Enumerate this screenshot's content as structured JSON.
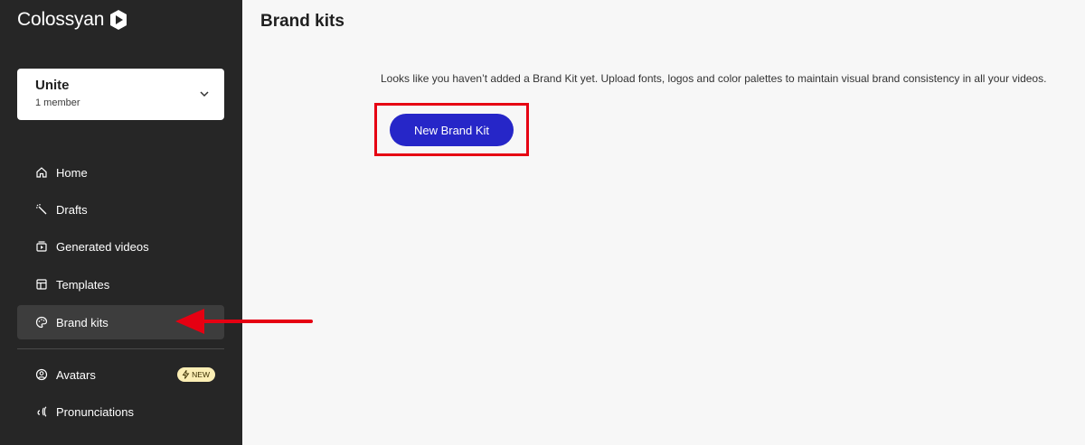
{
  "app": {
    "name": "Colossyan"
  },
  "workspace": {
    "name": "Unite",
    "members": "1 member"
  },
  "sidebar": {
    "items": [
      {
        "label": "Home",
        "icon": "home-icon"
      },
      {
        "label": "Drafts",
        "icon": "magic-wand-icon"
      },
      {
        "label": "Generated videos",
        "icon": "video-library-icon"
      },
      {
        "label": "Templates",
        "icon": "template-icon"
      },
      {
        "label": "Brand kits",
        "icon": "palette-icon",
        "active": true
      },
      {
        "label": "Avatars",
        "icon": "avatar-icon",
        "badge": "NEW"
      },
      {
        "label": "Pronunciations",
        "icon": "pronunciation-icon"
      }
    ]
  },
  "main": {
    "title": "Brand kits",
    "empty_message": "Looks like you haven’t added a Brand Kit yet. Upload fonts, logos and color palettes to maintain visual brand consistency in all your videos.",
    "new_button": "New Brand Kit"
  },
  "colors": {
    "sidebar_bg": "#262626",
    "primary_button": "#2626c8",
    "annotation_red": "#e60012",
    "badge_bg": "#fbeeb4"
  }
}
